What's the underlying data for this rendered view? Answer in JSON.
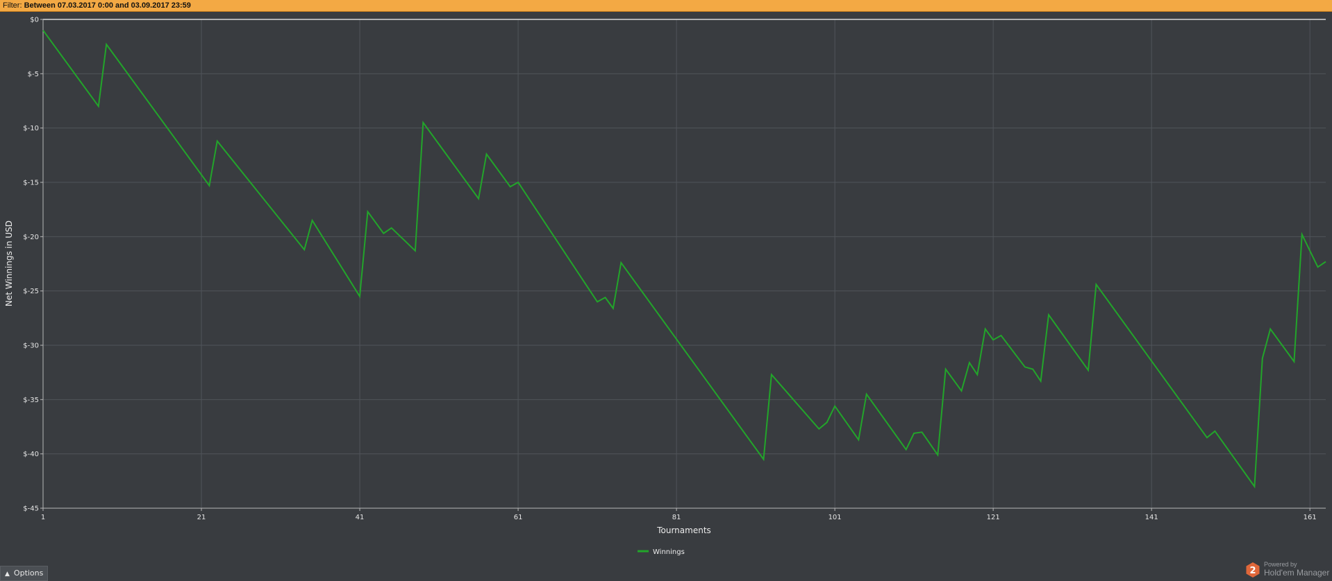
{
  "filter": {
    "label": "Filter: ",
    "value": "Between 07.03.2017 0:00 and 03.09.2017 23:59"
  },
  "chart_data": {
    "type": "line",
    "title": "",
    "xlabel": "Tournaments",
    "ylabel": "Net Winnings in USD",
    "xlim": [
      1,
      163
    ],
    "ylim": [
      -45,
      0
    ],
    "x_ticks": [
      1,
      21,
      41,
      61,
      81,
      101,
      121,
      141,
      161
    ],
    "y_ticks": [
      0,
      -5,
      -10,
      -15,
      -20,
      -25,
      -30,
      -35,
      -40,
      -45
    ],
    "y_tick_labels": [
      "$0",
      "$-5",
      "$-10",
      "$-15",
      "$-20",
      "$-25",
      "$-30",
      "$-35",
      "$-40",
      "$-45"
    ],
    "grid": true,
    "legend_position": "bottom-center",
    "series": [
      {
        "name": "Winnings",
        "color": "#22a52a",
        "points": [
          [
            1,
            -1.0
          ],
          [
            8,
            -8.0
          ],
          [
            9,
            -2.3
          ],
          [
            22,
            -15.3
          ],
          [
            23,
            -11.2
          ],
          [
            34,
            -21.2
          ],
          [
            35,
            -18.5
          ],
          [
            41,
            -25.5
          ],
          [
            42,
            -17.7
          ],
          [
            44,
            -19.7
          ],
          [
            45,
            -19.2
          ],
          [
            48,
            -21.3
          ],
          [
            49,
            -9.5
          ],
          [
            56,
            -16.5
          ],
          [
            57,
            -12.4
          ],
          [
            60,
            -15.4
          ],
          [
            61,
            -15.0
          ],
          [
            71,
            -26.0
          ],
          [
            72,
            -25.6
          ],
          [
            73,
            -26.6
          ],
          [
            74,
            -22.4
          ],
          [
            92,
            -40.5
          ],
          [
            93,
            -32.7
          ],
          [
            99,
            -37.7
          ],
          [
            100,
            -37.1
          ],
          [
            101,
            -35.6
          ],
          [
            104,
            -38.7
          ],
          [
            105,
            -34.5
          ],
          [
            110,
            -39.6
          ],
          [
            111,
            -38.1
          ],
          [
            112,
            -38.0
          ],
          [
            114,
            -40.1
          ],
          [
            115,
            -32.2
          ],
          [
            117,
            -34.2
          ],
          [
            118,
            -31.6
          ],
          [
            119,
            -32.7
          ],
          [
            120,
            -28.5
          ],
          [
            121,
            -29.5
          ],
          [
            122,
            -29.1
          ],
          [
            125,
            -32.0
          ],
          [
            126,
            -32.2
          ],
          [
            127,
            -33.3
          ],
          [
            128,
            -27.2
          ],
          [
            133,
            -32.3
          ],
          [
            134,
            -24.4
          ],
          [
            148,
            -38.5
          ],
          [
            149,
            -37.9
          ],
          [
            154,
            -43.0
          ],
          [
            155,
            -31.2
          ],
          [
            156,
            -28.5
          ],
          [
            159,
            -31.5
          ],
          [
            160,
            -19.8
          ],
          [
            162,
            -22.8
          ],
          [
            163,
            -22.3
          ]
        ]
      }
    ]
  },
  "controls": {
    "options_label": "Options",
    "options_icon": "chevron-up-icon"
  },
  "branding": {
    "powered_text": "Powered by",
    "product_name": "Hold'em Manager",
    "logo_digit": "2",
    "logo_color": "#e0673a"
  }
}
